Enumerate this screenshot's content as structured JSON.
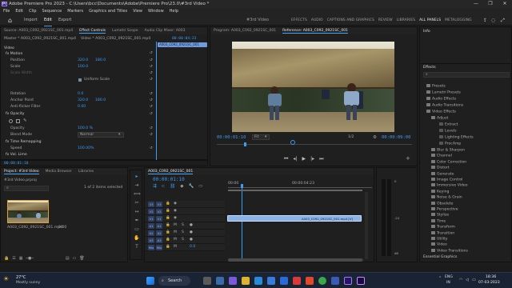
{
  "window": {
    "title": "Adobe Premiere Pro 2023 - C:\\Users\\bcc\\Documents\\Adobe\\Premiere Pro\\23.0\\#3rd Video *",
    "min": "—",
    "max": "❐",
    "close": "✕"
  },
  "menu": [
    "File",
    "Edit",
    "Clip",
    "Sequence",
    "Markers",
    "Graphics and Titles",
    "View",
    "Window",
    "Help"
  ],
  "workspace": {
    "home": "⌂",
    "import": "Import",
    "edit": "Edit",
    "export": "Export",
    "project_name": "#3rd Video",
    "tabs": [
      "EFFECTS",
      "AUDIO",
      "CAPTIONS AND GRAPHICS",
      "REVIEW",
      "LIBRARIES",
      "ALL PANELS",
      "METALOGGING"
    ],
    "active_tab": "ALL PANELS"
  },
  "source_panel": {
    "tabs": [
      "Source: A003_C092_0921SC_001.mp4",
      "Effect Controls",
      "Lumetri Scope",
      "Audio Clip Mixer: A003"
    ],
    "active_tab": "Effect Controls",
    "master": "Master * A003_C092_0921SC_001.mp4",
    "clip_ref": "Video * A003_C092_0921SC_001.mp4",
    "timecode_top": "00:00:04:23",
    "clip_bar": "A003_C092_0921SC_001",
    "section_video": "Video",
    "motion": "fx  Motion",
    "rows": [
      {
        "label": "Position",
        "v1": "320.0",
        "v2": "180.0"
      },
      {
        "label": "Scale",
        "v1": "100.0",
        "v2": ""
      },
      {
        "label": "Scale Width",
        "v1": "",
        "v2": ""
      },
      {
        "label": "",
        "v1": "",
        "v2": "Uniform Scale"
      },
      {
        "label": "Rotation",
        "v1": "0.0",
        "v2": ""
      },
      {
        "label": "Anchor Point",
        "v1": "320.0",
        "v2": "180.0"
      },
      {
        "label": "Anti-flicker Filter",
        "v1": "0.00",
        "v2": ""
      }
    ],
    "opacity": "fx  Opacity",
    "opacity_rows": [
      {
        "label": "Opacity",
        "v1": "100.0 %"
      },
      {
        "label": "Blend Mode",
        "v1": "Normal"
      }
    ],
    "time_remap": "fx  Time Remapping",
    "speed": {
      "label": "Speed",
      "v1": "100.00%"
    },
    "vol": "fx  Vol. Lime",
    "bottom_tc": "00:00:01:10"
  },
  "program_panel": {
    "tabs": [
      "Program: A003_C092_0921SC_001",
      "Reference: A003_C092_0921SC_001"
    ],
    "active_tab": "Reference: A003_C092_0921SC_001",
    "current_tc": "00:00:01:10",
    "fit": "Fit",
    "ratio": "1/2",
    "duration_tc": "00:00:09:00"
  },
  "info_panel": {
    "title": "Info",
    "effects_title": "Effects",
    "items": [
      "Presets",
      "Lumetri Presets",
      "Audio Effects",
      "Audio Transitions",
      "Video Effects"
    ],
    "sub_adjust": "Adjust",
    "adjust_items": [
      "Extract",
      "Levels",
      "Lighting Effects",
      "ProcAmp"
    ],
    "more": [
      "Blur & Sharpen",
      "Channel",
      "Color Correction",
      "Distort",
      "Generate",
      "Image Control",
      "Immersive Video",
      "Keying",
      "Noise & Grain",
      "Obsolete",
      "Perspective",
      "Stylize",
      "Time",
      "Transform",
      "Transition",
      "Utility",
      "Video",
      "Video Transitions"
    ],
    "bottom": "Essential Graphics"
  },
  "project_panel": {
    "tabs": [
      "Project: #3rd Video",
      "Media Browser",
      "Libraries"
    ],
    "active_tab": "Project: #3rd Video",
    "file": "#3rd Video.prproj",
    "selected": "1 of 2 items selected",
    "clip_name": "A003_C092_0921SC_001.mp4",
    "clip_dur": "9:00"
  },
  "timeline": {
    "tab": "A003_C092_0921SC_001",
    "timecode": "00:00:01:10",
    "ruler": [
      "00:00",
      "00:00:04:23"
    ],
    "tracks": [
      "V3",
      "V2",
      "V1",
      "A1",
      "A2",
      "A3",
      "Mix"
    ],
    "clip_label": "A003_C092_0921SC_001.mp4 [V]",
    "mix_value": "0.0"
  },
  "taskbar": {
    "weather_temp": "27°C",
    "weather_desc": "Mostly sunny",
    "search": "Search",
    "lang1": "ENG",
    "lang2": "IN",
    "time": "18:36",
    "date": "07-03-2023"
  },
  "colors": {
    "accent": "#3a9cf4",
    "clip": "#8ab4e8",
    "premiere": "#9a7cff",
    "bg": "#1d1d1d"
  }
}
